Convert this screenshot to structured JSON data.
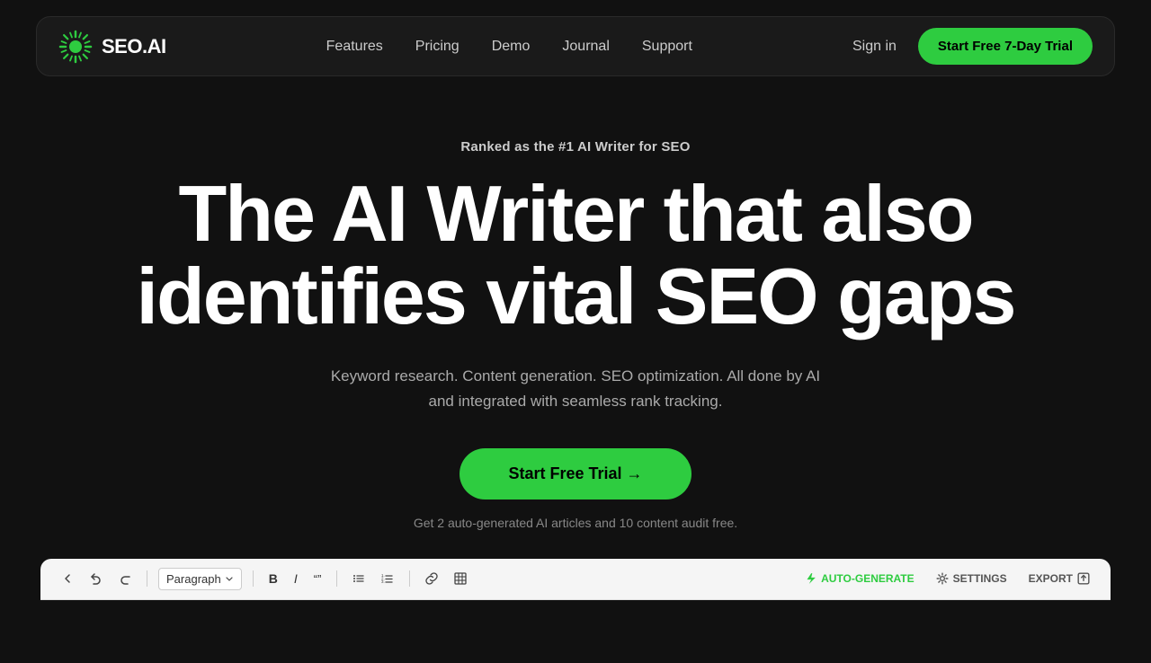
{
  "nav": {
    "logo_text": "SEO.AI",
    "links": [
      {
        "label": "Features",
        "id": "features"
      },
      {
        "label": "Pricing",
        "id": "pricing"
      },
      {
        "label": "Demo",
        "id": "demo"
      },
      {
        "label": "Journal",
        "id": "journal"
      },
      {
        "label": "Support",
        "id": "support"
      }
    ],
    "sign_in": "Sign in",
    "cta": "Start Free 7-Day Trial"
  },
  "hero": {
    "badge": "Ranked as the #1 AI Writer for SEO",
    "title_line1": "The AI Writer that also",
    "title_line2": "identifies vital SEO gaps",
    "subtitle": "Keyword research. Content generation. SEO optimization. All done by AI and integrated with seamless rank tracking.",
    "cta": "Start Free Trial →",
    "note": "Get 2 auto-generated AI articles and 10 content audit free."
  },
  "editor": {
    "paragraph_label": "Paragraph",
    "auto_generate": "AUTO-GENERATE",
    "settings": "SETTINGS",
    "export": "EXPORT"
  },
  "colors": {
    "green": "#2ecc40",
    "bg": "#111111",
    "nav_bg": "#1a1a1a"
  }
}
